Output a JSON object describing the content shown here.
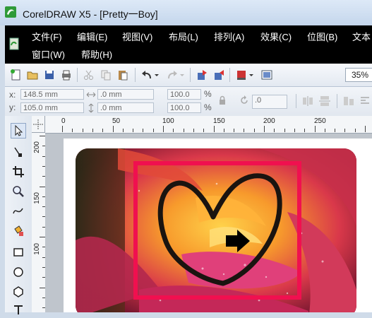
{
  "window": {
    "title": "CorelDRAW X5 - [Pretty一Boy]"
  },
  "menu": [
    {
      "label": "文件(F)"
    },
    {
      "label": "编辑(E)"
    },
    {
      "label": "视图(V)"
    },
    {
      "label": "布局(L)"
    },
    {
      "label": "排列(A)"
    },
    {
      "label": "效果(C)"
    },
    {
      "label": "位图(B)"
    },
    {
      "label": "文本"
    },
    {
      "label": "窗口(W)"
    },
    {
      "label": "帮助(H)"
    }
  ],
  "toolbar": {
    "zoom": "35%"
  },
  "property_bar": {
    "x_label": "x:",
    "x_value": "148.5 mm",
    "y_label": "y:",
    "y_value": "105.0 mm",
    "width_value": ".0 mm",
    "height_value": ".0 mm",
    "scale_x": "100.0",
    "scale_y": "100.0",
    "percent_x": "%",
    "percent_y": "%",
    "rotation": ".0"
  },
  "ruler": {
    "h_labels": [
      "0",
      "50",
      "100",
      "150",
      "200",
      "250"
    ],
    "v_labels": [
      "200",
      "150",
      "100"
    ]
  },
  "colors": {
    "menubar_bg": "#000000",
    "frame_pink": "#f0104f",
    "heart_stroke": "#1a1410"
  }
}
